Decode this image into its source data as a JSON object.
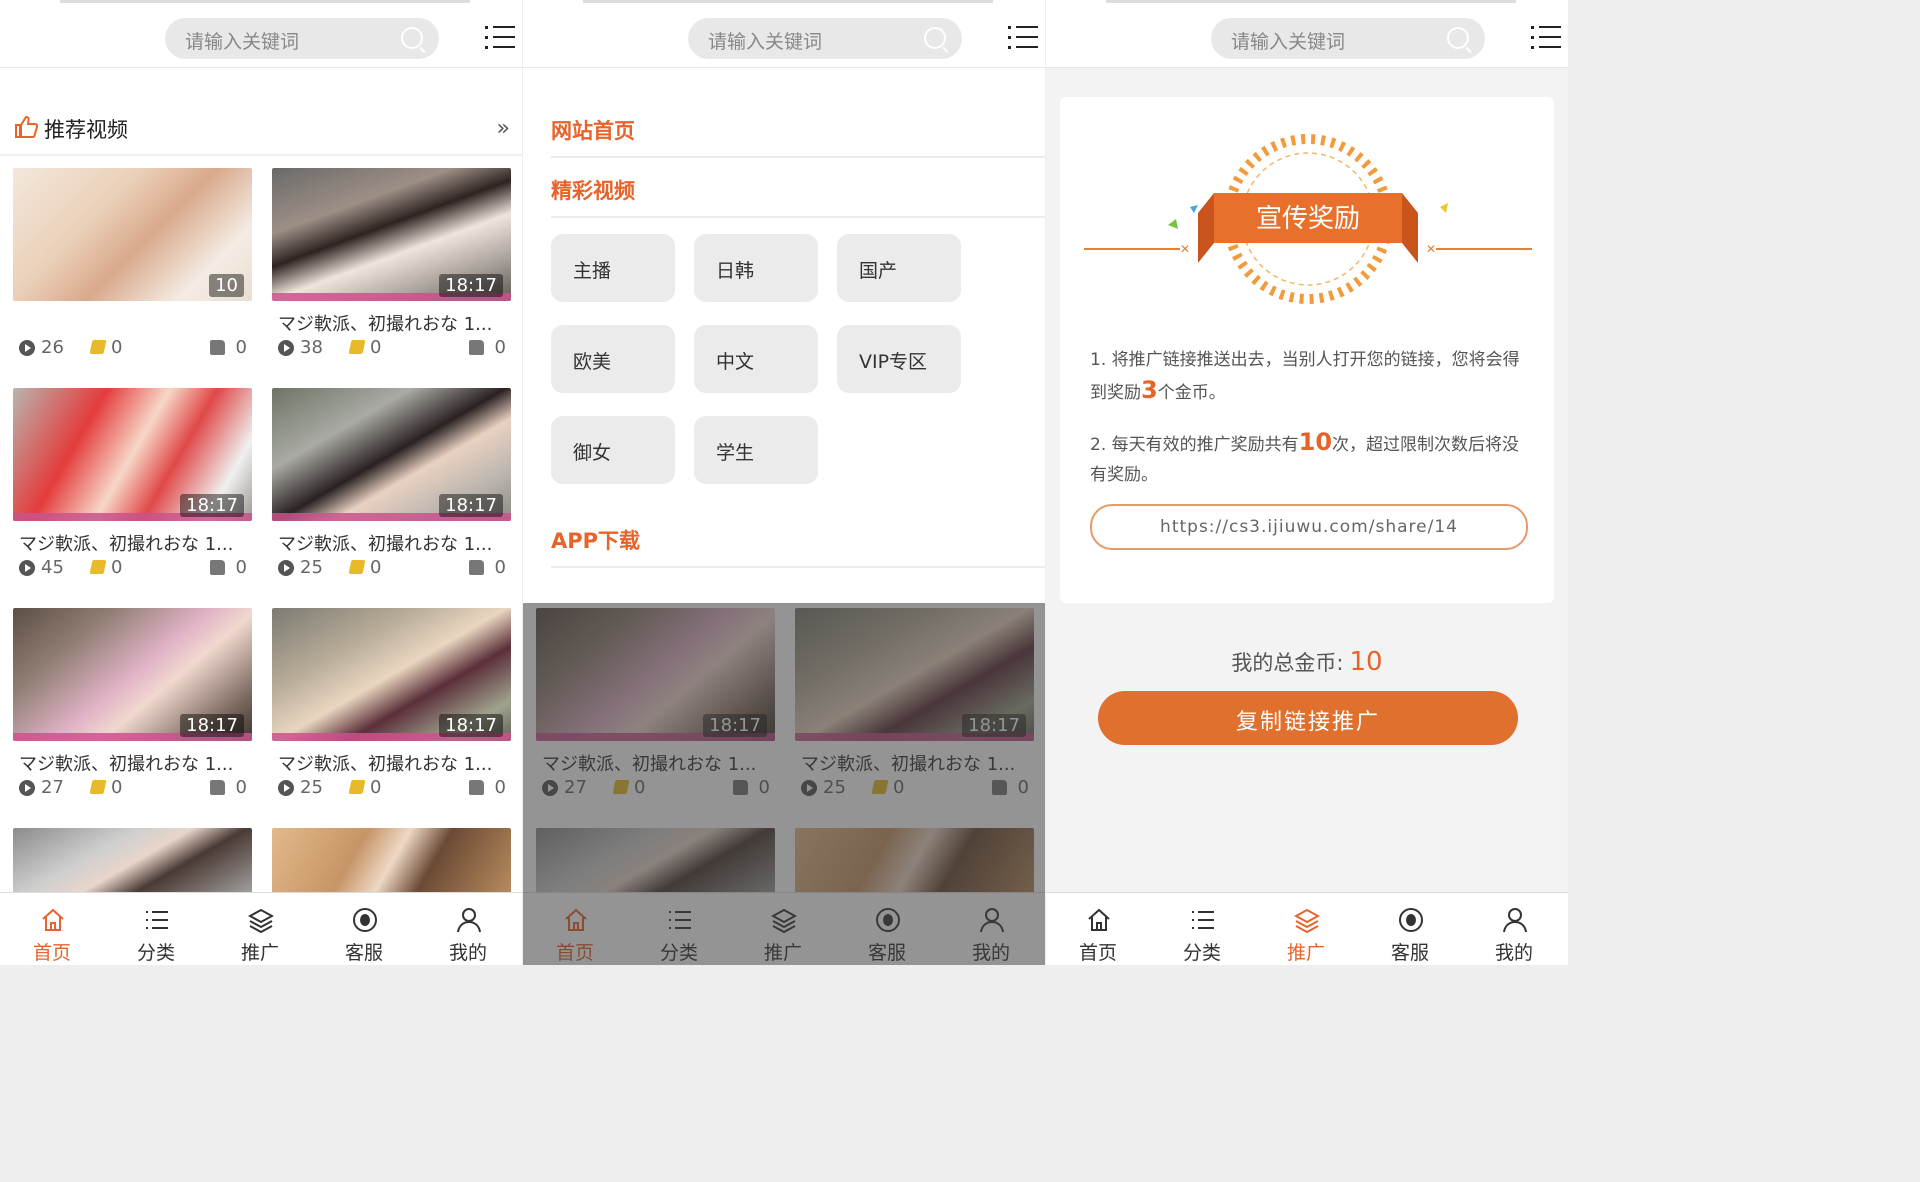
{
  "header": {
    "search_placeholder": "请输入关键词"
  },
  "recommend": {
    "title": "推荐视频",
    "videos": [
      {
        "duration": "10",
        "title": "",
        "views": "26",
        "coins": "0",
        "likes": "0"
      },
      {
        "duration": "18:17",
        "title": "マジ軟派、初撮れおな 1...",
        "views": "38",
        "coins": "0",
        "likes": "0"
      },
      {
        "duration": "18:17",
        "title": "マジ軟派、初撮れおな 1...",
        "views": "45",
        "coins": "0",
        "likes": "0"
      },
      {
        "duration": "18:17",
        "title": "マジ軟派、初撮れおな 1...",
        "views": "25",
        "coins": "0",
        "likes": "0"
      },
      {
        "duration": "18:17",
        "title": "マジ軟派、初撮れおな 1...",
        "views": "27",
        "coins": "0",
        "likes": "0"
      },
      {
        "duration": "18:17",
        "title": "マジ軟派、初撮れおな 1...",
        "views": "25",
        "coins": "0",
        "likes": "0"
      }
    ]
  },
  "menu": {
    "home": "网站首页",
    "featured": "精彩视频",
    "categories": [
      "主播",
      "日韩",
      "国产",
      "欧美",
      "中文",
      "VIP专区",
      "御女",
      "学生"
    ],
    "app_download": "APP下载"
  },
  "promo": {
    "badge": "宣传奖励",
    "rule1_a": "1. 将推广链接推送出去，当别人打开您的链接，您将会得到奖励",
    "rule1_num": "3",
    "rule1_b": "个金币。",
    "rule2_a": "2. 每天有效的推广奖励共有",
    "rule2_num": "10",
    "rule2_b": "次，超过限制次数后将没有奖励。",
    "share_link": "https://cs3.ijiuwu.com/share/14",
    "total_label": "我的总金币:",
    "total_value": "10",
    "copy_button": "复制链接推广"
  },
  "nav": {
    "items": [
      "首页",
      "分类",
      "推广",
      "客服",
      "我的"
    ]
  },
  "colors": {
    "accent": "#e8632a",
    "button": "#e0702d"
  }
}
